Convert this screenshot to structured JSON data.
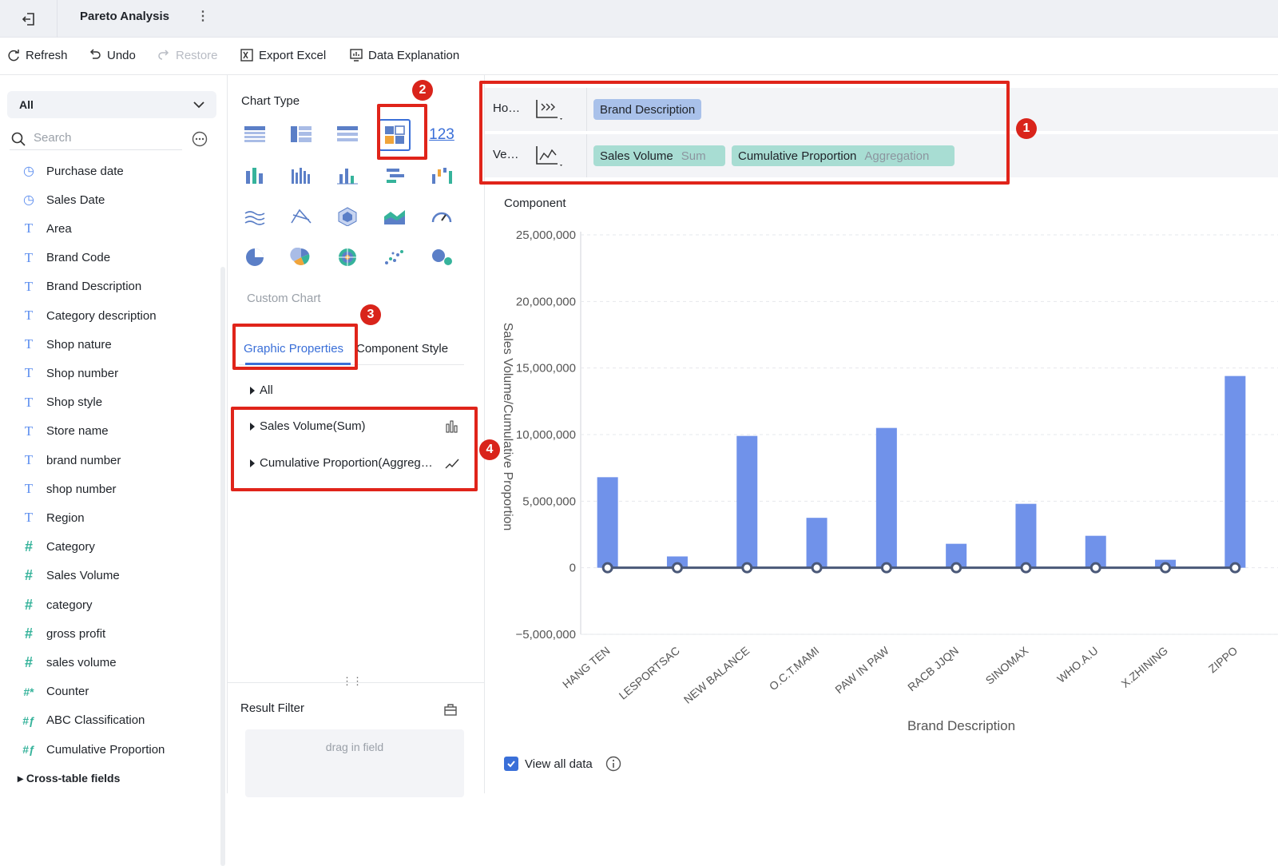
{
  "header": {
    "title": "Pareto Analysis"
  },
  "toolbar": {
    "refresh": "Refresh",
    "undo": "Undo",
    "restore": "Restore",
    "export": "Export Excel",
    "explanation": "Data Explanation"
  },
  "left": {
    "filter_value": "All",
    "search_placeholder": "Search",
    "fields": [
      {
        "label": "Purchase date",
        "icon": "clock-icon"
      },
      {
        "label": "Sales Date",
        "icon": "clock-icon"
      },
      {
        "label": "Area",
        "icon": "text-icon"
      },
      {
        "label": "Brand Code",
        "icon": "text-icon"
      },
      {
        "label": "Brand Description",
        "icon": "text-icon"
      },
      {
        "label": "Category description",
        "icon": "text-icon"
      },
      {
        "label": "Shop nature",
        "icon": "text-icon"
      },
      {
        "label": "Shop number",
        "icon": "text-icon"
      },
      {
        "label": "Shop style",
        "icon": "text-icon"
      },
      {
        "label": "Store name",
        "icon": "text-icon"
      },
      {
        "label": "brand number",
        "icon": "text-icon"
      },
      {
        "label": "shop number",
        "icon": "text-icon"
      },
      {
        "label": "Region",
        "icon": "text-icon"
      },
      {
        "label": "Category",
        "icon": "hash-icon"
      },
      {
        "label": "Sales Volume",
        "icon": "hash-icon"
      },
      {
        "label": "category",
        "icon": "hash-icon"
      },
      {
        "label": "gross profit",
        "icon": "hash-icon"
      },
      {
        "label": "sales volume",
        "icon": "hash-icon"
      },
      {
        "label": "Counter",
        "icon": "hash-star-icon"
      },
      {
        "label": "ABC Classification",
        "icon": "hash-formula-icon"
      },
      {
        "label": "Cumulative Proportion",
        "icon": "hash-formula-icon"
      }
    ],
    "cross_table": "Cross-table fields"
  },
  "middle": {
    "chart_type_label": "Chart Type",
    "custom_chart_label": "Custom Chart",
    "tab_graphic": "Graphic Properties",
    "tab_component": "Component Style",
    "all_label": "All",
    "prop_sales": "Sales Volume(Sum)",
    "prop_cumulative": "Cumulative Proportion(Aggreg…",
    "result_filter": "Result Filter",
    "drag_hint": "drag in field"
  },
  "badges": {
    "b1": "1",
    "b2": "2",
    "b3": "3",
    "b4": "4"
  },
  "axes": {
    "horizontal_label": "Ho…",
    "vertical_label": "Ve…",
    "h_pill": "Brand Description",
    "v_pill1": "Sales Volume",
    "v_pill1_sub": "Sum",
    "v_pill2": "Cumulative Proportion",
    "v_pill2_sub": "Aggregation"
  },
  "chart_title": "Component",
  "view_all": "View all data",
  "colors": {
    "bar": "#7092ea",
    "line": "#4a5878",
    "accent": "#3a6fd8",
    "highlight": "#e0241a"
  },
  "chart_data": {
    "type": "bar",
    "categories": [
      "HANG TEN",
      "LESPORTSAC",
      "NEW BALANCE",
      "O.C.T.MAMI",
      "PAW IN PAW",
      "RACB JJQN",
      "SINOMAX",
      "WHO.A.U",
      "X.ZHINING",
      "ZIPPO"
    ],
    "series": [
      {
        "name": "Sales Volume",
        "type": "bar",
        "values": [
          6800000,
          850000,
          9900000,
          3750000,
          10500000,
          1800000,
          4800000,
          2400000,
          600000,
          14400000
        ]
      },
      {
        "name": "Cumulative Proportion",
        "type": "line",
        "values": [
          0,
          0,
          0,
          0,
          0,
          0,
          0,
          0,
          0,
          0
        ]
      }
    ],
    "ylabel": "Sales Volume/Cumulative Proportion",
    "xlabel": "Brand Description",
    "ylim": [
      -5000000,
      25000000
    ],
    "yticks": [
      "25,000,000",
      "20,000,000",
      "15,000,000",
      "10,000,000",
      "5,000,000",
      "0",
      "−5,000,000"
    ],
    "grid": true
  }
}
